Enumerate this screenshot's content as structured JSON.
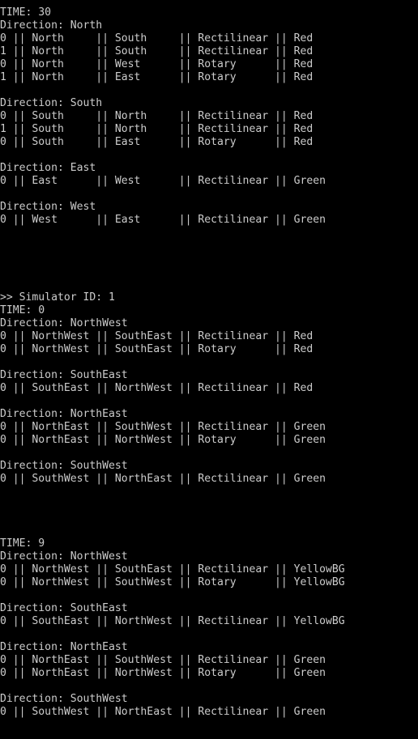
{
  "console": {
    "lines": [
      "TIME: 30",
      "Direction: North",
      "0 || North     || South     || Rectilinear || Red",
      "1 || North     || South     || Rectilinear || Red",
      "0 || North     || West      || Rotary      || Red",
      "1 || North     || East      || Rotary      || Red",
      "",
      "Direction: South",
      "0 || South     || North     || Rectilinear || Red",
      "1 || South     || North     || Rectilinear || Red",
      "0 || South     || East      || Rotary      || Red",
      "",
      "Direction: East",
      "0 || East      || West      || Rectilinear || Green",
      "",
      "Direction: West",
      "0 || West      || East      || Rectilinear || Green",
      "",
      "",
      "",
      "",
      "",
      ">> Simulator ID: 1",
      "TIME: 0",
      "Direction: NorthWest",
      "0 || NorthWest || SouthEast || Rectilinear || Red",
      "0 || NorthWest || SouthEast || Rotary      || Red",
      "",
      "Direction: SouthEast",
      "0 || SouthEast || NorthWest || Rectilinear || Red",
      "",
      "Direction: NorthEast",
      "0 || NorthEast || SouthWest || Rectilinear || Green",
      "0 || NorthEast || NorthWest || Rotary      || Green",
      "",
      "Direction: SouthWest",
      "0 || SouthWest || NorthEast || Rectilinear || Green",
      "",
      "",
      "",
      "",
      "TIME: 9",
      "Direction: NorthWest",
      "0 || NorthWest || SouthEast || Rectilinear || YellowBG",
      "0 || NorthWest || SouthWest || Rotary      || YellowBG",
      "",
      "Direction: SouthEast",
      "0 || SouthEast || NorthWest || Rectilinear || YellowBG",
      "",
      "Direction: NorthEast",
      "0 || NorthEast || SouthWest || Rectilinear || Green",
      "0 || NorthEast || NorthWest || Rotary      || Green",
      "",
      "Direction: SouthWest",
      "0 || SouthWest || NorthEast || Rectilinear || Green"
    ]
  },
  "colors": {
    "background": "#000000",
    "text": "#cccccc"
  }
}
